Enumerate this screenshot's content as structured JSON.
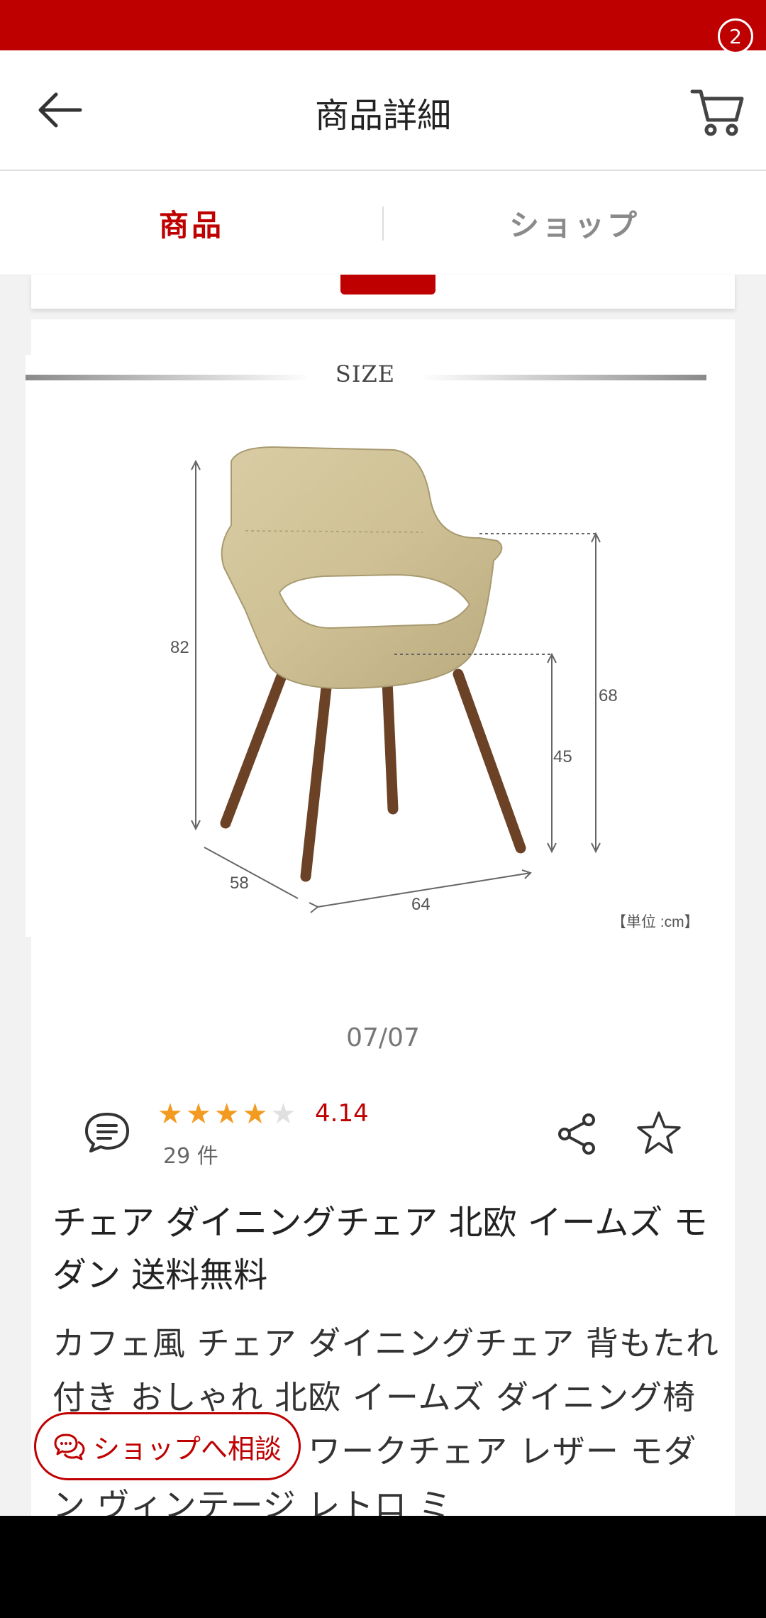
{
  "header": {
    "title": "商品詳細",
    "cart_badge": "2",
    "icons": {
      "back": "arrow-left-icon",
      "cart": "cart-icon"
    }
  },
  "tabs": [
    {
      "label": "商品",
      "active": true
    },
    {
      "label": "ショップ",
      "active": false
    }
  ],
  "size_image": {
    "heading": "SIZE",
    "dimensions": {
      "height": "82",
      "arm_height": "68",
      "seat_height": "45",
      "depth": "58",
      "width": "64"
    },
    "unit_note": "【単位 :cm】"
  },
  "gallery": {
    "counter": "07/07"
  },
  "rating": {
    "stars": 4,
    "max_stars": 5,
    "value": "4.14",
    "count": "29 件"
  },
  "product": {
    "title": "チェア ダイニングチェア 北欧 イームズ モダン 送料無料",
    "description": "カフェ風 チェア ダイニングチェア 背もたれ付き おしゃれ 北欧 イームズ ダイニング椅子 デスクチェア ワークチェア レザー モダン ヴィンテージ レトロ ミ"
  },
  "consult_button": {
    "label": "ショップへ相談"
  },
  "colors": {
    "brand": "#bf0000",
    "star": "#f39a20"
  }
}
